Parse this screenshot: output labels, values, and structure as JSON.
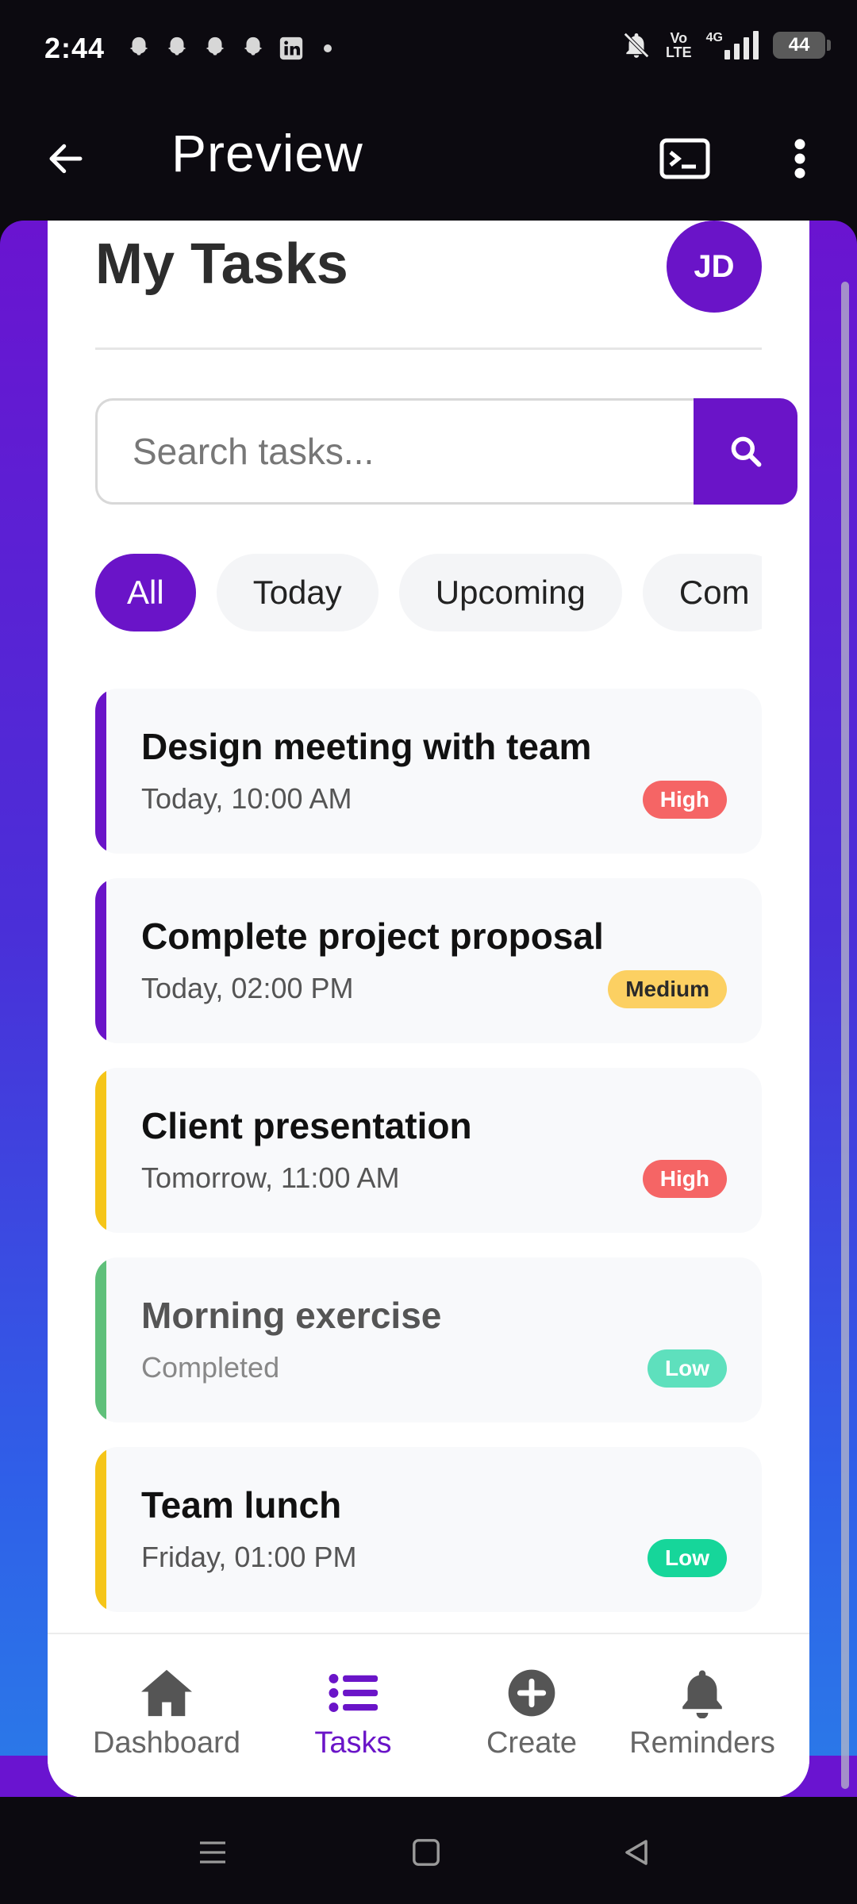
{
  "status_bar": {
    "time": "2:44",
    "network": "4G",
    "volte_line1": "Vo",
    "volte_line2": "LTE",
    "battery": "44"
  },
  "app_bar": {
    "title": "Preview"
  },
  "page": {
    "title": "My Tasks",
    "avatar_initials": "JD",
    "search_placeholder": "Search tasks..."
  },
  "filters": [
    {
      "label": "All",
      "active": true
    },
    {
      "label": "Today",
      "active": false
    },
    {
      "label": "Upcoming",
      "active": false
    },
    {
      "label": "Com",
      "active": false
    }
  ],
  "tasks": [
    {
      "title": "Design meeting with team",
      "time": "Today, 10:00 AM",
      "priority": "High",
      "bar_color": "#6a14c8",
      "badge_bg": "#f56565",
      "badge_fg": "#ffffff"
    },
    {
      "title": "Complete project proposal",
      "time": "Today, 02:00 PM",
      "priority": "Medium",
      "bar_color": "#6a14c8",
      "badge_bg": "#fcd062",
      "badge_fg": "#2a2a2a"
    },
    {
      "title": "Client presentation",
      "time": "Tomorrow, 11:00 AM",
      "priority": "High",
      "bar_color": "#f5c518",
      "badge_bg": "#f56565",
      "badge_fg": "#ffffff"
    },
    {
      "title": "Morning exercise",
      "time": "Completed",
      "priority": "Low",
      "bar_color": "#5fc07a",
      "badge_bg": "#5ee0bd",
      "badge_fg": "#ffffff"
    },
    {
      "title": "Team lunch",
      "time": "Friday, 01:00 PM",
      "priority": "Low",
      "bar_color": "#f5c518",
      "badge_bg": "#16d69a",
      "badge_fg": "#ffffff"
    }
  ],
  "bottom_nav": [
    {
      "label": "Dashboard",
      "icon": "home-icon",
      "active": false
    },
    {
      "label": "Tasks",
      "icon": "list-icon",
      "active": true
    },
    {
      "label": "Create",
      "icon": "plus-circle-icon",
      "active": false
    },
    {
      "label": "Reminders",
      "icon": "bell-icon",
      "active": false
    }
  ],
  "colors": {
    "accent": "#6a14c8",
    "high": "#f56565",
    "medium": "#fcd062",
    "low": "#16d69a"
  }
}
